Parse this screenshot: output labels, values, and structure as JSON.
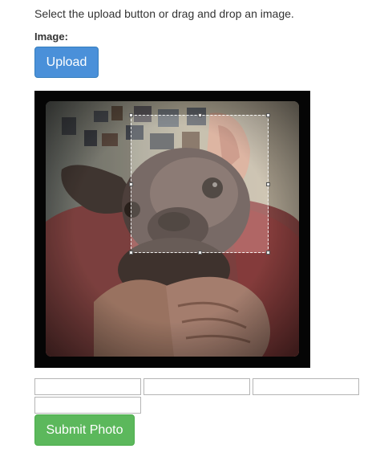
{
  "instructions": "Select the upload button or drag and drop an image.",
  "image_label": "Image:",
  "upload_button": "Upload",
  "submit_button": "Submit Photo",
  "inputs": [
    "",
    "",
    "",
    ""
  ],
  "colors": {
    "upload": "#4a90d9",
    "submit": "#5cb85c",
    "frame": "#050505"
  }
}
